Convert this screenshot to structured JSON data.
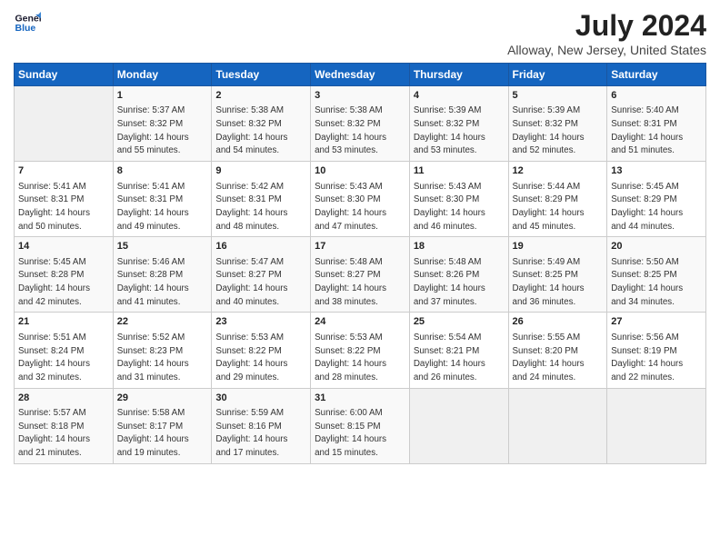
{
  "logo": {
    "line1": "General",
    "line2": "Blue"
  },
  "title": "July 2024",
  "subtitle": "Alloway, New Jersey, United States",
  "days": [
    "Sunday",
    "Monday",
    "Tuesday",
    "Wednesday",
    "Thursday",
    "Friday",
    "Saturday"
  ],
  "weeks": [
    [
      {
        "date": "",
        "info": ""
      },
      {
        "date": "1",
        "info": "Sunrise: 5:37 AM\nSunset: 8:32 PM\nDaylight: 14 hours\nand 55 minutes."
      },
      {
        "date": "2",
        "info": "Sunrise: 5:38 AM\nSunset: 8:32 PM\nDaylight: 14 hours\nand 54 minutes."
      },
      {
        "date": "3",
        "info": "Sunrise: 5:38 AM\nSunset: 8:32 PM\nDaylight: 14 hours\nand 53 minutes."
      },
      {
        "date": "4",
        "info": "Sunrise: 5:39 AM\nSunset: 8:32 PM\nDaylight: 14 hours\nand 53 minutes."
      },
      {
        "date": "5",
        "info": "Sunrise: 5:39 AM\nSunset: 8:32 PM\nDaylight: 14 hours\nand 52 minutes."
      },
      {
        "date": "6",
        "info": "Sunrise: 5:40 AM\nSunset: 8:31 PM\nDaylight: 14 hours\nand 51 minutes."
      }
    ],
    [
      {
        "date": "7",
        "info": "Sunrise: 5:41 AM\nSunset: 8:31 PM\nDaylight: 14 hours\nand 50 minutes."
      },
      {
        "date": "8",
        "info": "Sunrise: 5:41 AM\nSunset: 8:31 PM\nDaylight: 14 hours\nand 49 minutes."
      },
      {
        "date": "9",
        "info": "Sunrise: 5:42 AM\nSunset: 8:31 PM\nDaylight: 14 hours\nand 48 minutes."
      },
      {
        "date": "10",
        "info": "Sunrise: 5:43 AM\nSunset: 8:30 PM\nDaylight: 14 hours\nand 47 minutes."
      },
      {
        "date": "11",
        "info": "Sunrise: 5:43 AM\nSunset: 8:30 PM\nDaylight: 14 hours\nand 46 minutes."
      },
      {
        "date": "12",
        "info": "Sunrise: 5:44 AM\nSunset: 8:29 PM\nDaylight: 14 hours\nand 45 minutes."
      },
      {
        "date": "13",
        "info": "Sunrise: 5:45 AM\nSunset: 8:29 PM\nDaylight: 14 hours\nand 44 minutes."
      }
    ],
    [
      {
        "date": "14",
        "info": "Sunrise: 5:45 AM\nSunset: 8:28 PM\nDaylight: 14 hours\nand 42 minutes."
      },
      {
        "date": "15",
        "info": "Sunrise: 5:46 AM\nSunset: 8:28 PM\nDaylight: 14 hours\nand 41 minutes."
      },
      {
        "date": "16",
        "info": "Sunrise: 5:47 AM\nSunset: 8:27 PM\nDaylight: 14 hours\nand 40 minutes."
      },
      {
        "date": "17",
        "info": "Sunrise: 5:48 AM\nSunset: 8:27 PM\nDaylight: 14 hours\nand 38 minutes."
      },
      {
        "date": "18",
        "info": "Sunrise: 5:48 AM\nSunset: 8:26 PM\nDaylight: 14 hours\nand 37 minutes."
      },
      {
        "date": "19",
        "info": "Sunrise: 5:49 AM\nSunset: 8:25 PM\nDaylight: 14 hours\nand 36 minutes."
      },
      {
        "date": "20",
        "info": "Sunrise: 5:50 AM\nSunset: 8:25 PM\nDaylight: 14 hours\nand 34 minutes."
      }
    ],
    [
      {
        "date": "21",
        "info": "Sunrise: 5:51 AM\nSunset: 8:24 PM\nDaylight: 14 hours\nand 32 minutes."
      },
      {
        "date": "22",
        "info": "Sunrise: 5:52 AM\nSunset: 8:23 PM\nDaylight: 14 hours\nand 31 minutes."
      },
      {
        "date": "23",
        "info": "Sunrise: 5:53 AM\nSunset: 8:22 PM\nDaylight: 14 hours\nand 29 minutes."
      },
      {
        "date": "24",
        "info": "Sunrise: 5:53 AM\nSunset: 8:22 PM\nDaylight: 14 hours\nand 28 minutes."
      },
      {
        "date": "25",
        "info": "Sunrise: 5:54 AM\nSunset: 8:21 PM\nDaylight: 14 hours\nand 26 minutes."
      },
      {
        "date": "26",
        "info": "Sunrise: 5:55 AM\nSunset: 8:20 PM\nDaylight: 14 hours\nand 24 minutes."
      },
      {
        "date": "27",
        "info": "Sunrise: 5:56 AM\nSunset: 8:19 PM\nDaylight: 14 hours\nand 22 minutes."
      }
    ],
    [
      {
        "date": "28",
        "info": "Sunrise: 5:57 AM\nSunset: 8:18 PM\nDaylight: 14 hours\nand 21 minutes."
      },
      {
        "date": "29",
        "info": "Sunrise: 5:58 AM\nSunset: 8:17 PM\nDaylight: 14 hours\nand 19 minutes."
      },
      {
        "date": "30",
        "info": "Sunrise: 5:59 AM\nSunset: 8:16 PM\nDaylight: 14 hours\nand 17 minutes."
      },
      {
        "date": "31",
        "info": "Sunrise: 6:00 AM\nSunset: 8:15 PM\nDaylight: 14 hours\nand 15 minutes."
      },
      {
        "date": "",
        "info": ""
      },
      {
        "date": "",
        "info": ""
      },
      {
        "date": "",
        "info": ""
      }
    ]
  ]
}
